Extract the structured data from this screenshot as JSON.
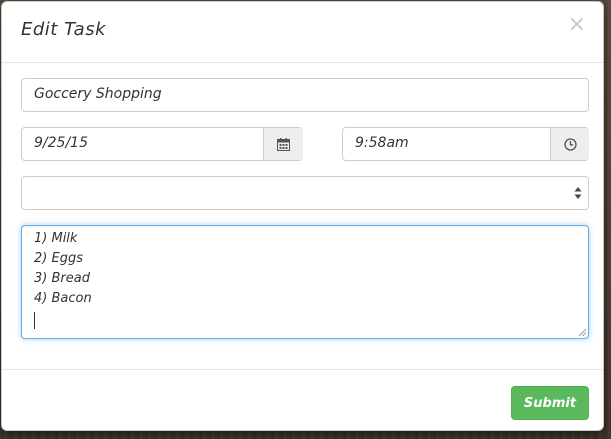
{
  "modal": {
    "title": "Edit Task",
    "close_label": "×"
  },
  "form": {
    "task_name": "Goccery Shopping",
    "date": "9/25/15",
    "time": "9:58am",
    "category": "",
    "notes": [
      "1) Milk",
      "2) Eggs",
      "3) Bread",
      "4) Bacon"
    ]
  },
  "footer": {
    "submit_label": "Submit"
  },
  "colors": {
    "submit": "#5cb85c",
    "focus_border": "#66afe9",
    "addon_bg": "#eeeeee"
  },
  "icons": {
    "date_addon": "calendar-icon",
    "time_addon": "clock-icon",
    "select": "updown-arrows-icon"
  }
}
